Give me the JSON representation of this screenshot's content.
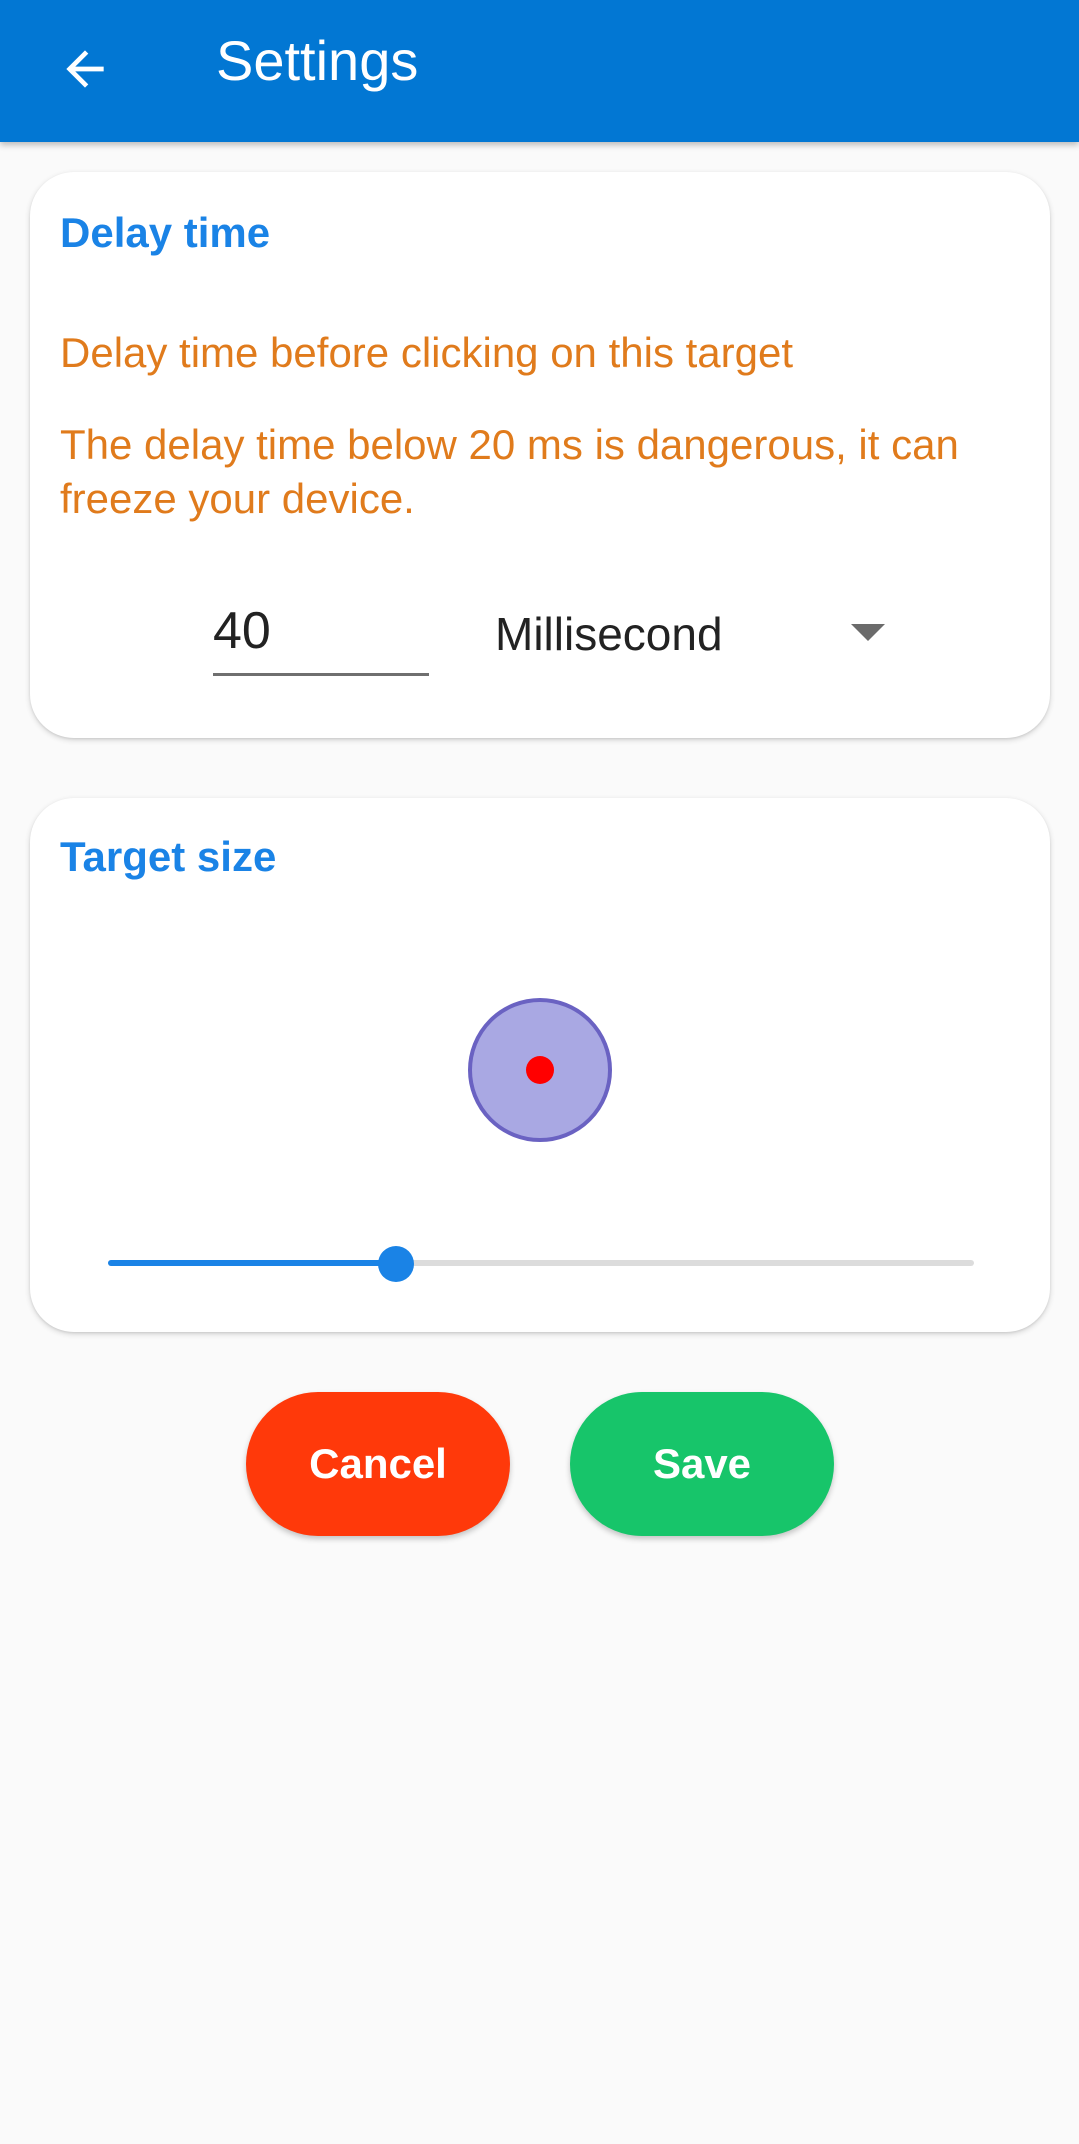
{
  "app_bar": {
    "title": "Settings",
    "back_icon": "arrow-left-icon",
    "color": "#0277d3"
  },
  "delay_card": {
    "title": "Delay time",
    "description": "Delay time before clicking on this target",
    "warning": "The delay time below 20 ms is dangerous, it can freeze your device.",
    "input_value": "40",
    "unit_selected": "Millisecond"
  },
  "target_card": {
    "title": "Target size",
    "slider_value_fraction": 0.333
  },
  "buttons": {
    "cancel_label": "Cancel",
    "save_label": "Save"
  },
  "colors": {
    "accent": "#1a83e6",
    "warning_text": "#e07b1c",
    "cancel": "#ff390a",
    "save": "#17c56a",
    "target_fill": "#a9a8e3",
    "target_border": "#6a62c2",
    "target_dot": "#ff0000"
  }
}
